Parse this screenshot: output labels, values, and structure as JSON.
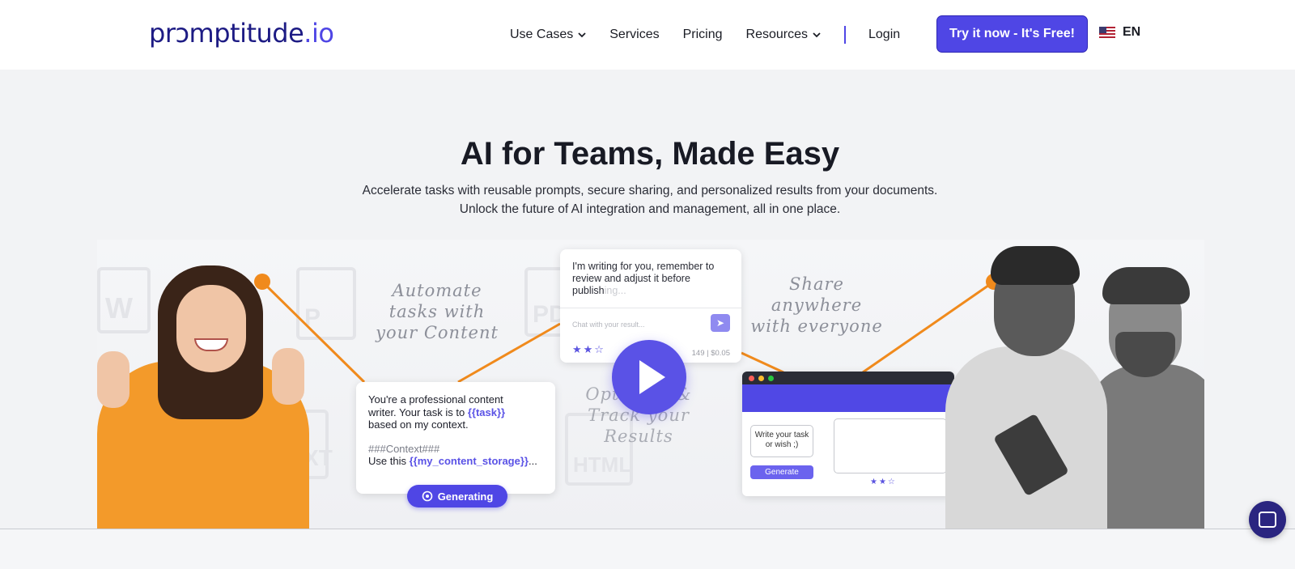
{
  "nav": {
    "logo_main": "prɔmptitude",
    "logo_suffix": ".io",
    "items": [
      {
        "label": "Use Cases",
        "has_dropdown": true
      },
      {
        "label": "Services",
        "has_dropdown": false
      },
      {
        "label": "Pricing",
        "has_dropdown": false
      },
      {
        "label": "Resources",
        "has_dropdown": true
      }
    ],
    "login": "Login",
    "cta": "Try it now - It's Free!",
    "language": "EN",
    "language_icon": "us-flag-icon"
  },
  "hero": {
    "title": "AI for Teams, Made Easy",
    "subtitle_line1": "Accelerate tasks with reusable prompts, secure sharing, and personalized results from your documents.",
    "subtitle_line2": "Unlock the future of AI integration and management, all in one place."
  },
  "illustration": {
    "script_automate": [
      "Automate",
      "tasks with",
      "your Content"
    ],
    "script_share": [
      "Share",
      "anywhere",
      "with everyone"
    ],
    "script_optimize": [
      "Optimize &",
      "Track your",
      "Results"
    ],
    "prompt_card": {
      "line1": "You're a professional content",
      "line2_pre": "writer. Your task is to ",
      "var_task": "{{task}}",
      "line3": "based on my context.",
      "context_label": "###Context###",
      "line5_pre": "Use this ",
      "var_storage": "{{my_content_storage}}",
      "line5_post": "..."
    },
    "generating_button": "Generating",
    "chat_card": {
      "message": "I'm writing for you, remember to review and adjust it before publish",
      "message_faded": "ing...",
      "placeholder": "Chat with your result...",
      "stars": "★★☆",
      "meta": "149 | $0.05"
    },
    "app_card": {
      "wish_text": "Write your task or wish ;)",
      "generate_label": "Generate",
      "stars": "★★☆"
    },
    "bg_docs": [
      "W",
      "P",
      "PDF",
      "TXT",
      "HTML"
    ],
    "colors": {
      "accent": "#4f46e5",
      "line": "#f08a1c"
    }
  }
}
